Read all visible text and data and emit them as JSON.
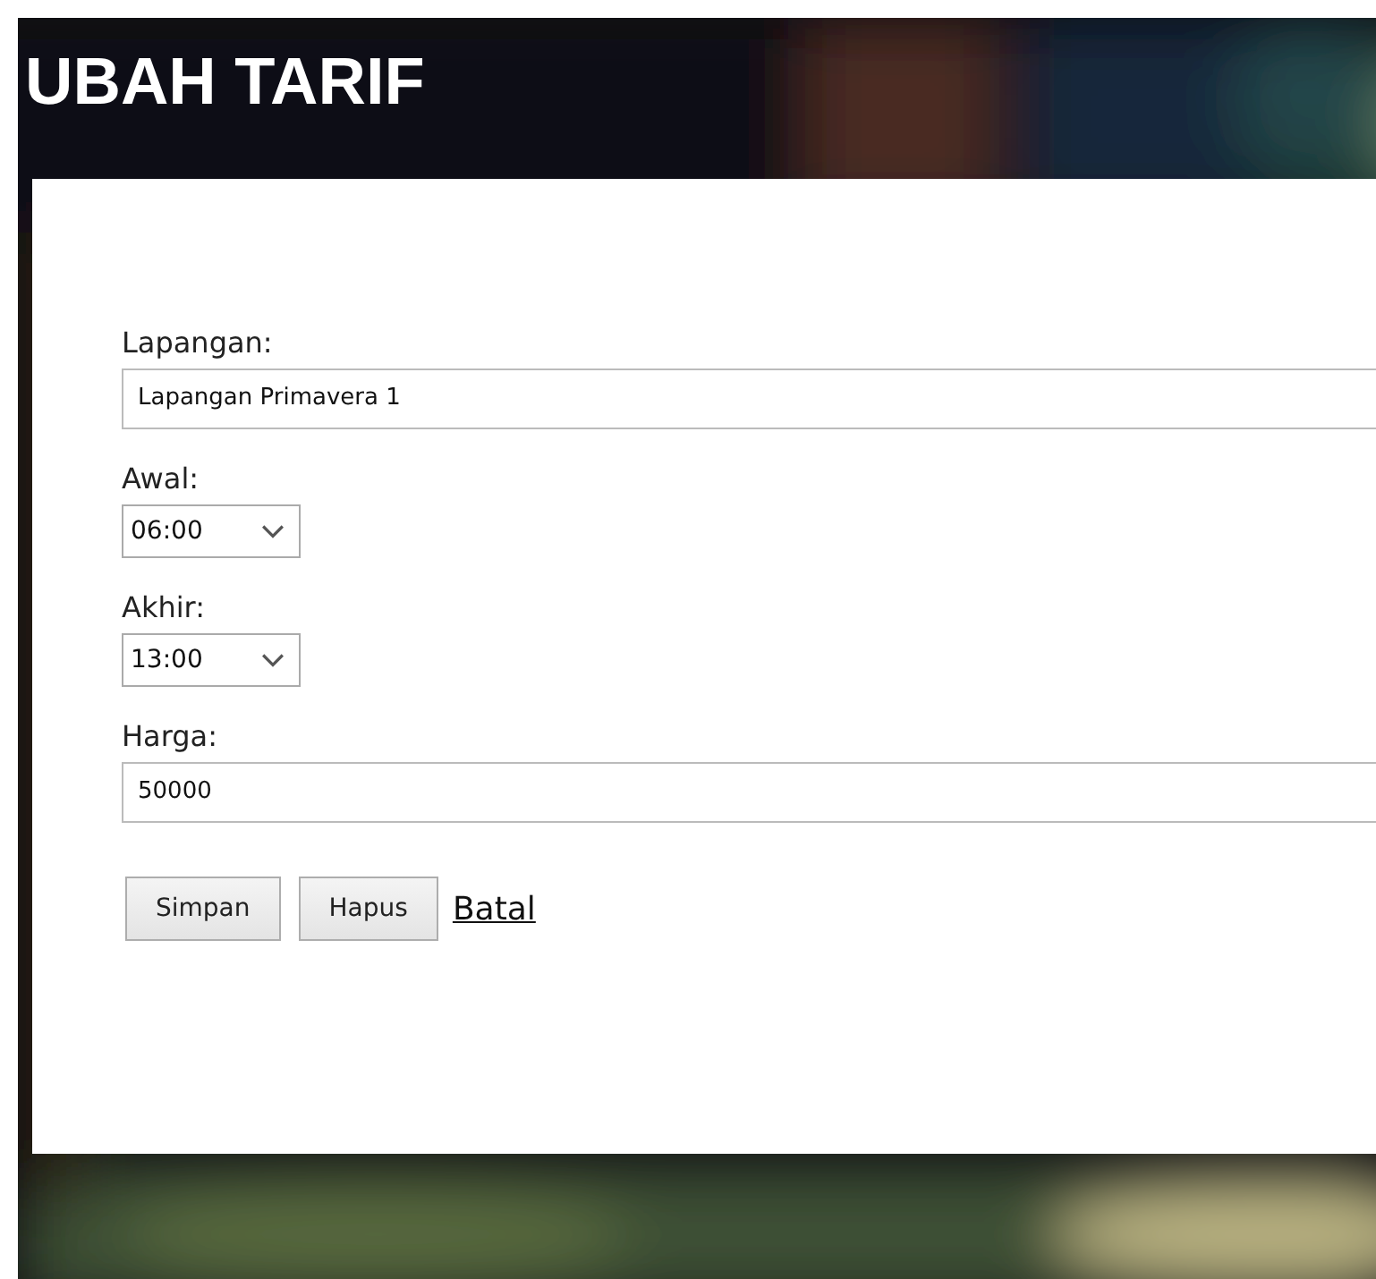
{
  "title": "UBAH TARIF",
  "fields": [
    {
      "kind": "text",
      "label": "Lapangan:",
      "value": "Lapangan Primavera 1"
    },
    {
      "kind": "select",
      "label": "Awal:",
      "value": "06:00"
    },
    {
      "kind": "select",
      "label": "Akhir:",
      "value": "13:00"
    },
    {
      "kind": "text",
      "label": "Harga:",
      "value": "50000"
    }
  ],
  "buttons": [
    "Simpan",
    "Hapus"
  ],
  "link": "Batal"
}
